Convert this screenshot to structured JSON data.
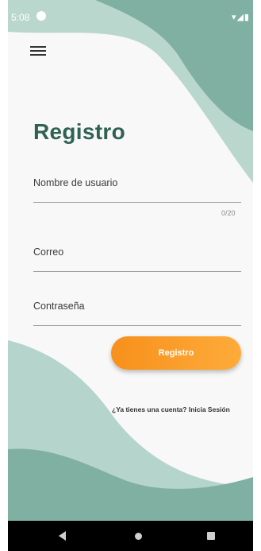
{
  "status_bar": {
    "time": "5:08",
    "right_icons": "▾◢▮"
  },
  "header": {
    "menu_icon": "hamburger-menu-icon"
  },
  "form": {
    "title": "Registro",
    "username": {
      "label": "Nombre de usuario",
      "counter": "0/20"
    },
    "email": {
      "label": "Correo"
    },
    "password": {
      "label": "Contraseña"
    },
    "submit_label": "Registro",
    "login_prompt": "¿Ya tienes una cuenta? Inicia Sesión"
  },
  "nav_bar": {
    "back_icon": "back-triangle-icon",
    "home_icon": "home-circle-icon",
    "recents_icon": "recents-square-icon"
  },
  "colors": {
    "teal": "#7fb0a2",
    "light_teal": "#b5d4cb",
    "title": "#2f6253",
    "button_start": "#f8901c",
    "button_end": "#fdab3a"
  }
}
